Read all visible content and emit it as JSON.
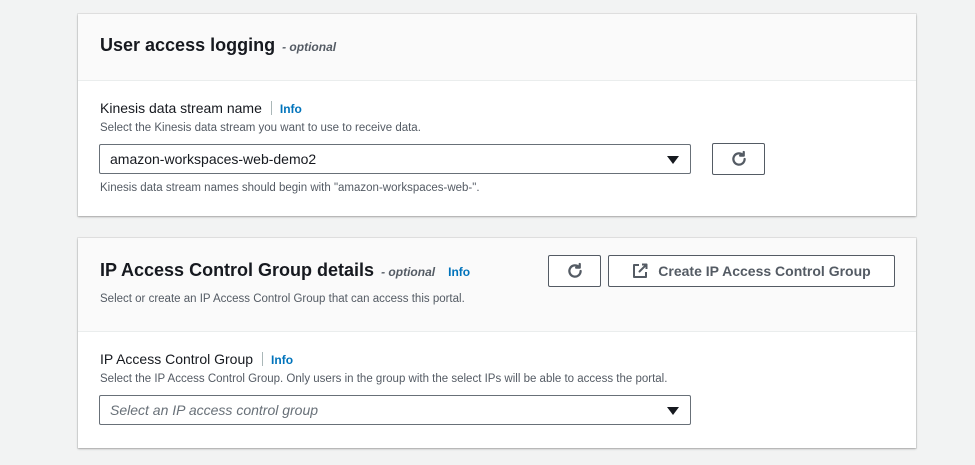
{
  "logging": {
    "title": "User access logging",
    "optional": "- optional",
    "field_label": "Kinesis data stream name",
    "info": "Info",
    "description": "Select the Kinesis data stream you want to use to receive data.",
    "select_value": "amazon-workspaces-web-demo2",
    "hint": "Kinesis data stream names should begin with \"amazon-workspaces-web-\"."
  },
  "ip_group": {
    "title": "IP Access Control Group details",
    "optional": "- optional",
    "info": "Info",
    "description": "Select or create an IP Access Control Group that can access this portal.",
    "create_button": "Create IP Access Control Group",
    "field_label": "IP Access Control Group",
    "field_info": "Info",
    "field_description": "Select the IP Access Control Group. Only users in the group with the select IPs will be able to access the portal.",
    "select_placeholder": "Select an IP access control group"
  },
  "icons": [
    "refresh-icon",
    "external-link-icon",
    "caret-down-icon"
  ],
  "colors": {
    "link": "#0073bb",
    "text": "#16191f",
    "secondary_text": "#545b64"
  }
}
